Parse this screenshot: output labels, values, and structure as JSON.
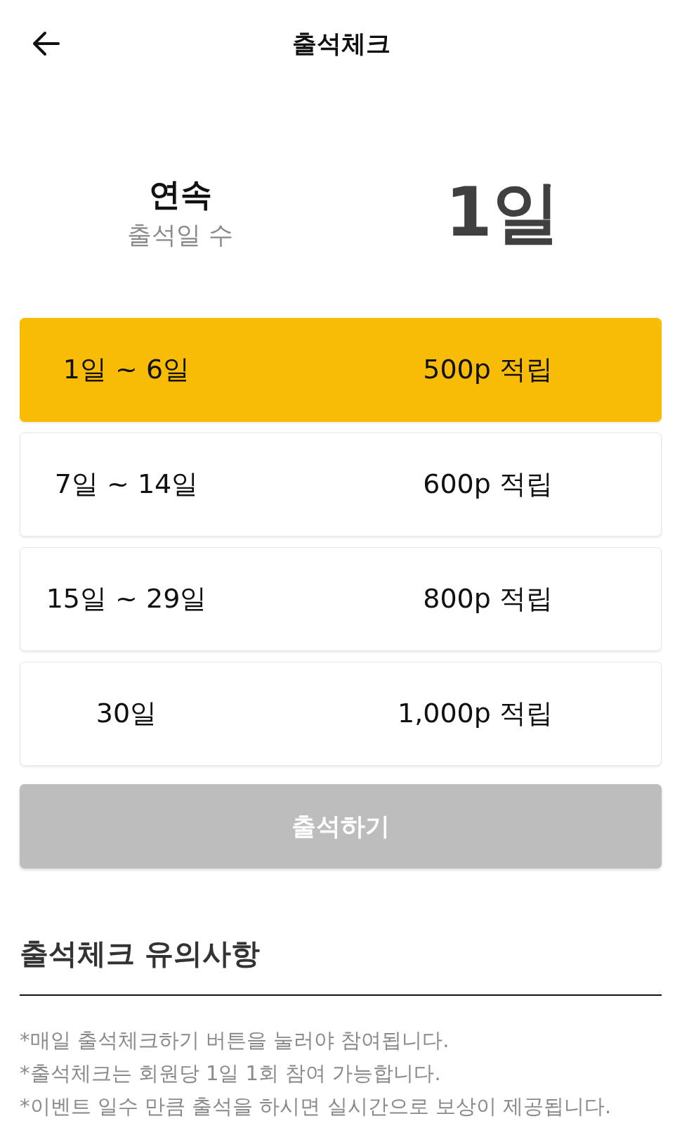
{
  "header": {
    "title": "출석체크"
  },
  "streak": {
    "label": "연속",
    "sublabel": "출석일 수",
    "value": "1일"
  },
  "reward_tiers": [
    {
      "range": "1일 ~ 6일",
      "reward": "500p 적립",
      "selected": true
    },
    {
      "range": "7일 ~ 14일",
      "reward": "600p 적립",
      "selected": false
    },
    {
      "range": "15일 ~ 29일",
      "reward": "800p 적립",
      "selected": false
    },
    {
      "range": "30일",
      "reward": "1,000p 적립",
      "selected": false
    }
  ],
  "attend_button": {
    "label": "출석하기",
    "disabled": true
  },
  "notice": {
    "title": "출석체크 유의사항",
    "items": [
      "*매일 출석체크하기 버튼을 눌러야 참여됩니다.",
      "*출석체크는 회원당 1일 1회 참여 가능합니다.",
      "*이벤트 일수 만큼 출석을 하시면 실시간으로 보상이 제공됩니다."
    ]
  }
}
